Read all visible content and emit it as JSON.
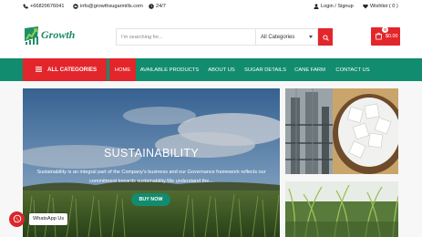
{
  "topbar": {
    "phone": "+66820676041",
    "email": "info@growthsugarmills.com",
    "hours": "24/7",
    "login": "Login / Signup",
    "wishlist": "Wishlist ( 0 )"
  },
  "header": {
    "logo_text": "Growth",
    "search_placeholder": "I'm searching for...",
    "category_selected": "All Categories",
    "cart_count": "0",
    "cart_total": "$0.00"
  },
  "nav": {
    "all_categories": "ALL CATEGORIES",
    "items": [
      {
        "label": "HOME"
      },
      {
        "label": "AVAILABLE PRODUCTS"
      },
      {
        "label": "ABOUT US"
      },
      {
        "label": "SUGAR DETAILS"
      },
      {
        "label": "CANE FARM"
      },
      {
        "label": "CONTACT US"
      }
    ]
  },
  "hero": {
    "title": "SUSTAINABILITY",
    "text": "Sustainability is an integral part of the Company's business and our Governance framework reflects our commitment towards sustainability.We understand the...",
    "button": "BUY NOW"
  },
  "whatsapp": {
    "label": "WhatsApp Us"
  },
  "colors": {
    "accent_red": "#e2262b",
    "nav_green": "#128c6e"
  },
  "icons": [
    "phone-icon",
    "email-icon",
    "clock-icon",
    "user-icon",
    "heart-icon",
    "search-icon",
    "cart-icon",
    "menu-icon",
    "whatsapp-icon"
  ]
}
